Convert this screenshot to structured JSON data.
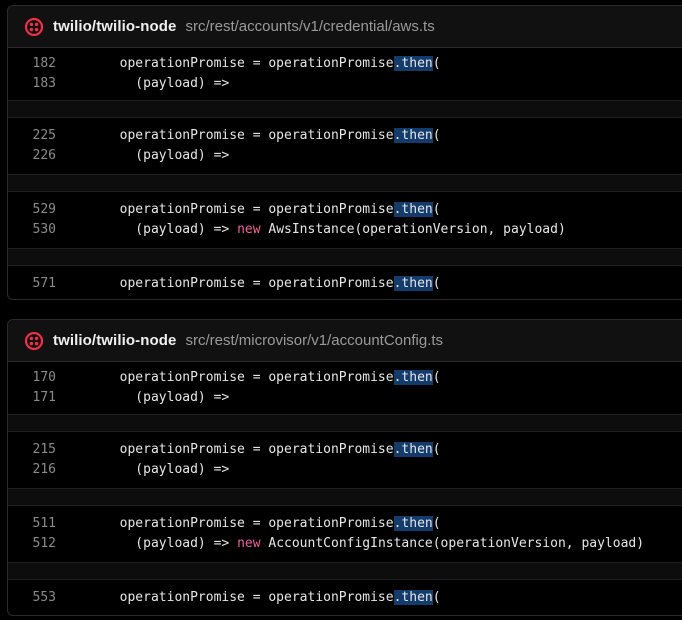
{
  "colors": {
    "background": "#000000",
    "header_bg": "#111111",
    "border": "#2a2a2a",
    "highlight": "#133b6b",
    "keyword": "#f0609a",
    "logo": "#f22f46"
  },
  "results": [
    {
      "repo": "twilio/twilio-node",
      "path": "src/rest/accounts/v1/credential/aws.ts",
      "logo_icon": "twilio-logo-icon",
      "hunks": [
        {
          "lines": [
            {
              "num": "182",
              "pre": "  operationPromise = operationPromise",
              "match": ".then",
              "post": "(",
              "kw": "",
              "rest": ""
            },
            {
              "num": "183",
              "pre": "    (payload) =>",
              "match": "",
              "post": "",
              "kw": "",
              "rest": ""
            }
          ]
        },
        {
          "lines": [
            {
              "num": "225",
              "pre": "  operationPromise = operationPromise",
              "match": ".then",
              "post": "(",
              "kw": "",
              "rest": ""
            },
            {
              "num": "226",
              "pre": "    (payload) =>",
              "match": "",
              "post": "",
              "kw": "",
              "rest": ""
            }
          ]
        },
        {
          "lines": [
            {
              "num": "529",
              "pre": "  operationPromise = operationPromise",
              "match": ".then",
              "post": "(",
              "kw": "",
              "rest": ""
            },
            {
              "num": "530",
              "pre": "    (payload) => ",
              "match": "",
              "post": "",
              "kw": "new",
              "rest": " AwsInstance(operationVersion, payload)"
            }
          ]
        },
        {
          "lines": [
            {
              "num": "571",
              "pre": "  operationPromise = operationPromise",
              "match": ".then",
              "post": "(",
              "kw": "",
              "rest": ""
            }
          ]
        }
      ]
    },
    {
      "repo": "twilio/twilio-node",
      "path": "src/rest/microvisor/v1/accountConfig.ts",
      "logo_icon": "twilio-logo-icon",
      "hunks": [
        {
          "lines": [
            {
              "num": "170",
              "pre": "  operationPromise = operationPromise",
              "match": ".then",
              "post": "(",
              "kw": "",
              "rest": ""
            },
            {
              "num": "171",
              "pre": "    (payload) =>",
              "match": "",
              "post": "",
              "kw": "",
              "rest": ""
            }
          ]
        },
        {
          "lines": [
            {
              "num": "215",
              "pre": "  operationPromise = operationPromise",
              "match": ".then",
              "post": "(",
              "kw": "",
              "rest": ""
            },
            {
              "num": "216",
              "pre": "    (payload) =>",
              "match": "",
              "post": "",
              "kw": "",
              "rest": ""
            }
          ]
        },
        {
          "lines": [
            {
              "num": "511",
              "pre": "  operationPromise = operationPromise",
              "match": ".then",
              "post": "(",
              "kw": "",
              "rest": ""
            },
            {
              "num": "512",
              "pre": "    (payload) => ",
              "match": "",
              "post": "",
              "kw": "new",
              "rest": " AccountConfigInstance(operationVersion, payload)"
            }
          ]
        },
        {
          "lines": [
            {
              "num": "553",
              "pre": "  operationPromise = operationPromise",
              "match": ".then",
              "post": "(",
              "kw": "",
              "rest": ""
            }
          ]
        }
      ]
    }
  ]
}
